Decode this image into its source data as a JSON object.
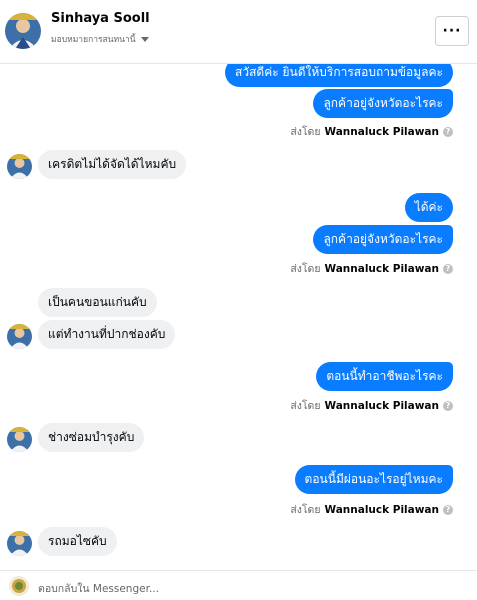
{
  "header": {
    "contact_name": "Sinhaya Sooll",
    "assign_label": "มอบหมายการสนทนานี้",
    "more_label": "···"
  },
  "thread": {
    "messages": [
      {
        "dir": "out",
        "text": "สวัสดีค่ะ ยินดีให้บริการสอบถามข้อมูลคะ"
      },
      {
        "dir": "out",
        "text": "ลูกค้าอยู่จังหวัดอะไรคะ"
      },
      {
        "dir": "meta",
        "label": "ส่งโดย",
        "name": "Wannaluck Pilawan"
      },
      {
        "dir": "in",
        "text": "เครดิตไม่ได้จัดได้ไหมคับ"
      },
      {
        "dir": "out",
        "text": "ได้ค่ะ"
      },
      {
        "dir": "out",
        "text": "ลูกค้าอยู่จังหวัดอะไรคะ"
      },
      {
        "dir": "meta",
        "label": "ส่งโดย",
        "name": "Wannaluck Pilawan"
      },
      {
        "dir": "in",
        "text": "เป็นคนขอนแก่นคับ"
      },
      {
        "dir": "in",
        "text": "แต่ทำงานที่ปากช่องคับ"
      },
      {
        "dir": "out",
        "text": "ตอนนี้ทำอาชีพอะไรคะ"
      },
      {
        "dir": "meta",
        "label": "ส่งโดย",
        "name": "Wannaluck Pilawan"
      },
      {
        "dir": "in",
        "text": "ช่างซ่อมบำรุงคับ"
      },
      {
        "dir": "out",
        "text": "ตอนนี้มีผ่อนอะไรอยู่ไหมคะ"
      },
      {
        "dir": "meta",
        "label": "ส่งโดย",
        "name": "Wannaluck Pilawan"
      },
      {
        "dir": "in",
        "text": "รถมอไซคับ"
      }
    ]
  },
  "composer": {
    "placeholder": "ตอบกลับใน Messenger..."
  },
  "colors": {
    "outgoing": "#0a7cff",
    "incoming": "#eef0f2"
  }
}
